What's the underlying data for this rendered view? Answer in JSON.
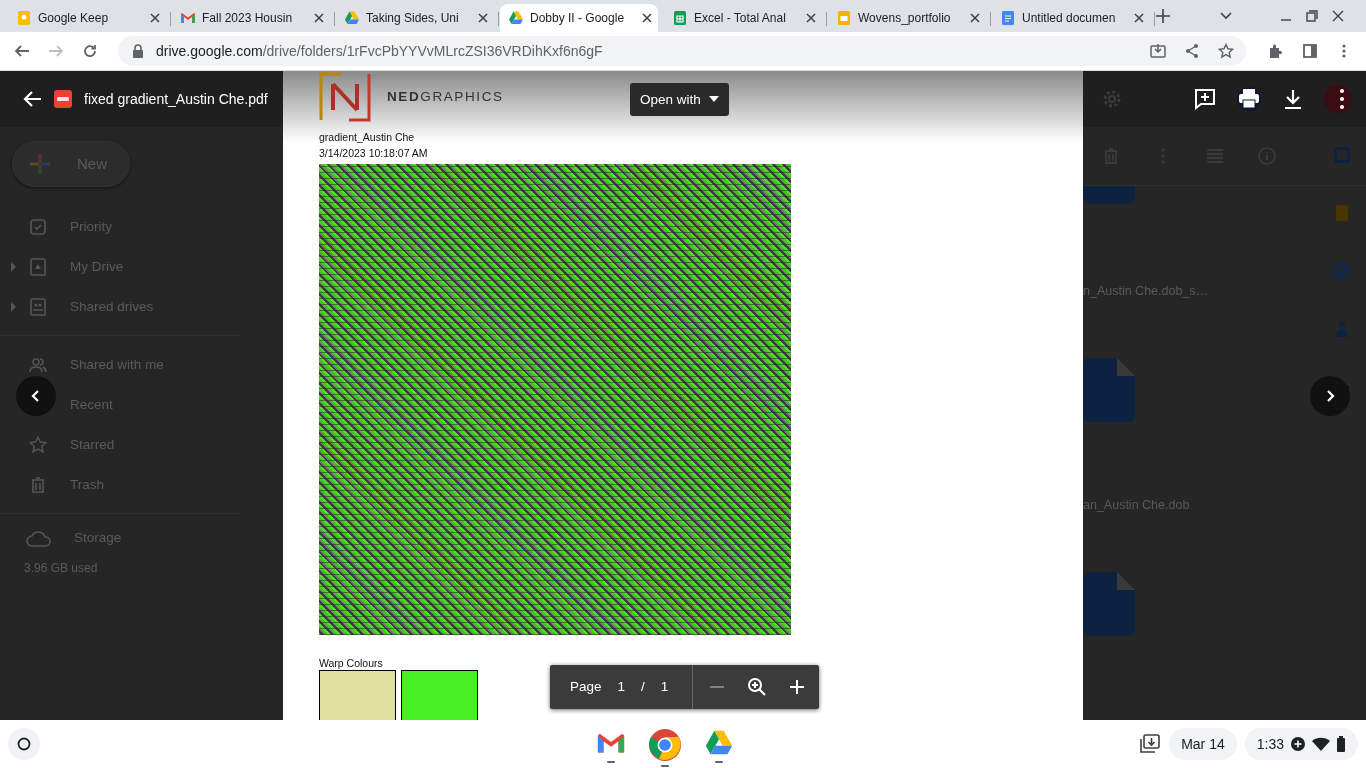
{
  "tabs": [
    {
      "title": "Google Keep",
      "kind": "keep",
      "selected": false
    },
    {
      "title": "Fall 2023 Housin",
      "kind": "gmail",
      "selected": false
    },
    {
      "title": "Taking Sides, Uni",
      "kind": "drive",
      "selected": false
    },
    {
      "title": "Dobby II - Google",
      "kind": "drive",
      "selected": true
    },
    {
      "title": "Excel - Total Anal",
      "kind": "sheets",
      "selected": false
    },
    {
      "title": "Wovens_portfolio",
      "kind": "slides",
      "selected": false
    },
    {
      "title": "Untitled documen",
      "kind": "docs",
      "selected": false
    }
  ],
  "address": {
    "host": "drive.google.com",
    "path": "/drive/folders/1rFvcPbYYVvMLrcZSI36VRDihKxf6n6gF"
  },
  "drive": {
    "new_label": "New",
    "sidebar": [
      {
        "label": "Priority",
        "kind": "priority",
        "expandable": false
      },
      {
        "label": "My Drive",
        "kind": "mydrive",
        "expandable": true
      },
      {
        "label": "Shared drives",
        "kind": "shared",
        "expandable": true
      },
      {
        "label": "Shared with me",
        "kind": "people",
        "expandable": false
      },
      {
        "label": "Recent",
        "kind": "recent",
        "expandable": false
      },
      {
        "label": "Starred",
        "kind": "star",
        "expandable": false
      },
      {
        "label": "Trash",
        "kind": "trash",
        "expandable": false
      }
    ],
    "storage_label": "Storage",
    "storage_used": "3.96 GB used",
    "files": [
      "n_Austin Che.dob_s…",
      "an_Austin Che.dob"
    ]
  },
  "viewer": {
    "file_name": "fixed gradient_Austin Che.pdf",
    "open_with": "Open with",
    "page_label": "Page",
    "page": "1",
    "separator": "/",
    "total": "1"
  },
  "document": {
    "logo_bold": "NED",
    "logo_light": "GRAPHICS",
    "name": "gradient_Austin Che",
    "date": "3/14/2023 10:18:07 AM",
    "warp_label": "Warp Colours",
    "warp_colors": [
      {
        "color": "#e0e0a0"
      },
      {
        "color": "#46ef23"
      }
    ]
  },
  "shelf": {
    "apps": [
      {
        "kind": "gmail"
      },
      {
        "kind": "chrome"
      },
      {
        "kind": "drive"
      }
    ],
    "date": "Mar 14",
    "time": "1:33"
  }
}
